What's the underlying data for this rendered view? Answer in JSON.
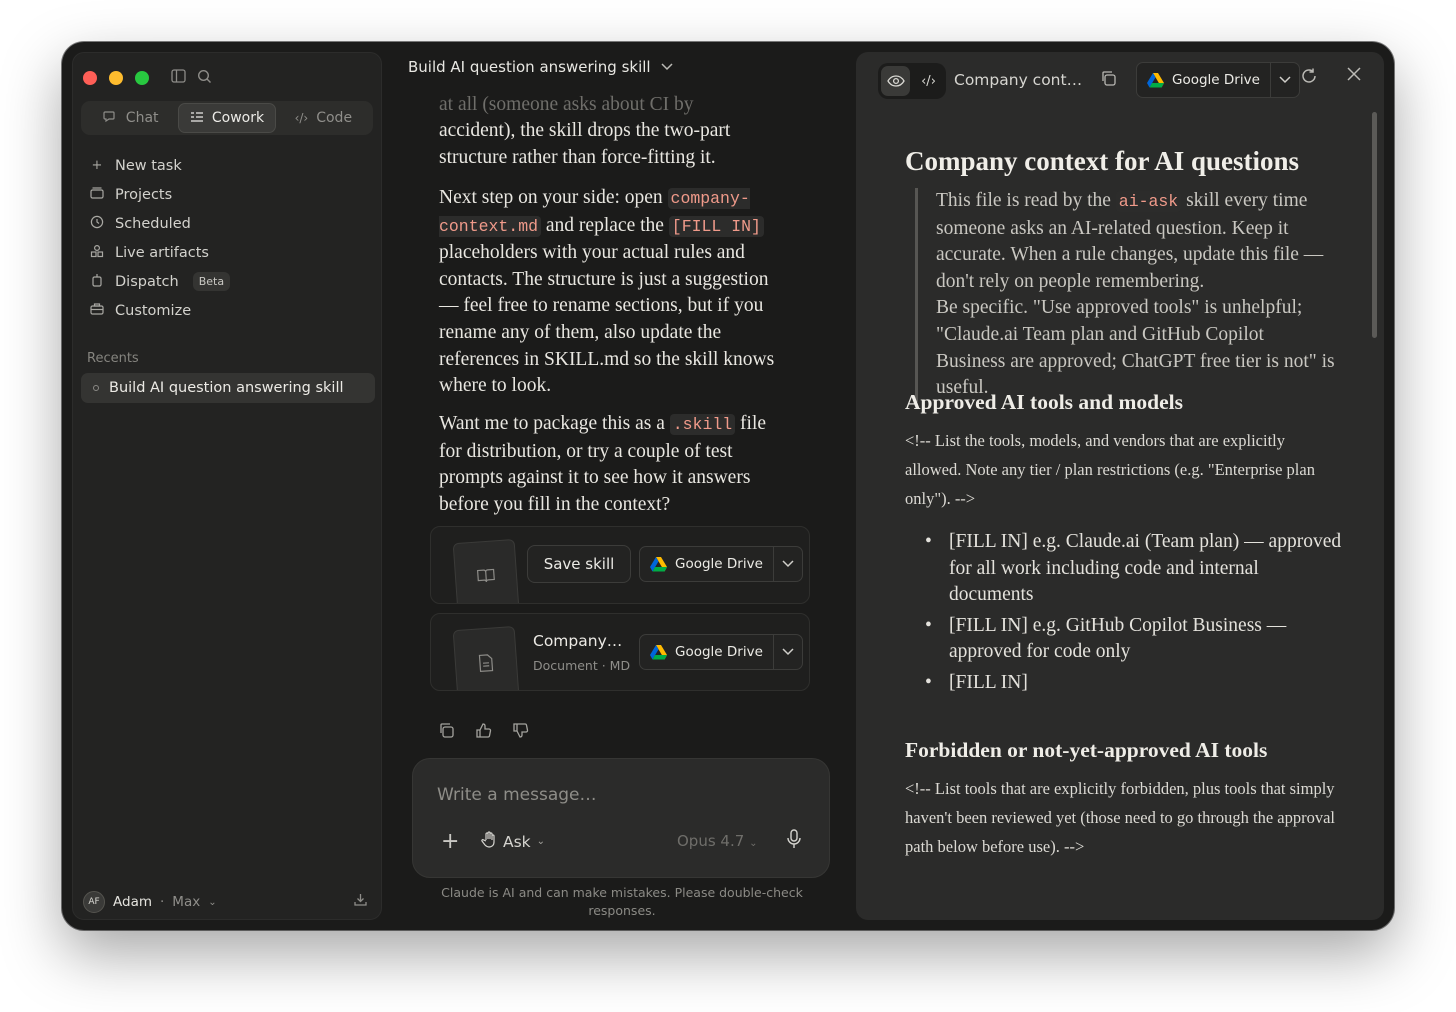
{
  "sidebar": {
    "modes": [
      {
        "label": "Chat",
        "icon": "chat-bubble-icon"
      },
      {
        "label": "Cowork",
        "icon": "cowork-icon",
        "active": true
      },
      {
        "label": "Code",
        "icon": "code-brackets-icon"
      }
    ],
    "nav": [
      {
        "label": "New task",
        "icon": "plus-icon"
      },
      {
        "label": "Projects",
        "icon": "folder-icon"
      },
      {
        "label": "Scheduled",
        "icon": "clock-icon"
      },
      {
        "label": "Live artifacts",
        "icon": "artifacts-icon"
      },
      {
        "label": "Dispatch",
        "icon": "dispatch-icon",
        "badge": "Beta"
      },
      {
        "label": "Customize",
        "icon": "briefcase-icon"
      }
    ],
    "recents_label": "Recents",
    "recents": [
      "Build AI question answering skill"
    ],
    "user": {
      "initials": "AF",
      "name": "Adam",
      "plan": "Max"
    }
  },
  "chat": {
    "title": "Build AI question answering skill",
    "faded_line": "at all (someone asks about CI by",
    "para1_rest": "accident), the skill drops the two-part structure rather than force-fitting it.",
    "para2": {
      "t1": "Next step on your side: open ",
      "code1": "company-context.md",
      "t2": " and replace the ",
      "code2": "[FILL IN]",
      "t3": " placeholders with your actual rules and contacts. The structure is just a suggestion — feel free to rename sections, but if you rename any of them, also update the references in SKILL.md so the skill knows where to look."
    },
    "para3": {
      "t1": "Want me to package this as a ",
      "code1": ".skill",
      "t2": " file for distribution, or try a couple of test prompts against it to see how it answers before you fill in the context?"
    },
    "card1": {
      "button": "Save skill",
      "drive": "Google Drive"
    },
    "card2": {
      "title": "Company…",
      "subtitle": "Document · MD",
      "drive": "Google Drive"
    },
    "composer": {
      "placeholder": "Write a message…",
      "mode": "Ask",
      "model": "Opus 4.7"
    },
    "disclaimer": "Claude is AI and can make mistakes. Please double-check responses."
  },
  "panel": {
    "title": "Company cont…",
    "drive": "Google Drive",
    "doc": {
      "h1": "Company context for AI questions",
      "quote": {
        "t1": "This file is read by the ",
        "code": "ai-ask",
        "t2": " skill every time someone asks an AI-related question. Keep it accurate. When a rule changes, update this file — don't rely on people remembering.",
        "t3": "Be specific. \"Use approved tools\" is unhelpful; \"Claude.ai Team plan and GitHub Copilot Business are approved; ChatGPT free tier is not\" is useful."
      },
      "h2a": "Approved AI tools and models",
      "comment_a": "<!-- List the tools, models, and vendors that are explicitly allowed. Note any tier / plan restrictions (e.g. \"Enterprise plan only\"). -->",
      "items_a": [
        "[FILL IN] e.g. Claude.ai (Team plan) — approved for all work including code and internal documents",
        "[FILL IN] e.g. GitHub Copilot Business — approved for code only",
        "[FILL IN]"
      ],
      "h2b": "Forbidden or not-yet-approved AI tools",
      "comment_b": "<!-- List tools that are explicitly forbidden, plus tools that simply haven't been reviewed yet (those need to go through the approval path below before use). -->"
    }
  },
  "colors": {
    "window_bg": "#1b1b1a",
    "panel_bg": "#2b2b2a",
    "code_text": "#f09a8a"
  }
}
